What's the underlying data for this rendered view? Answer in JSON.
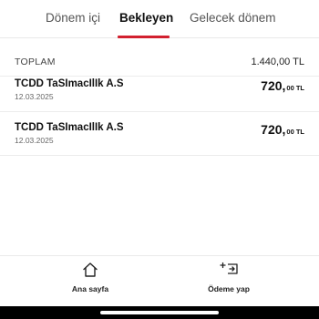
{
  "tabs": [
    {
      "label": "Dönem içi",
      "active": false
    },
    {
      "label": "Bekleyen",
      "active": true
    },
    {
      "label": "Gelecek dönem",
      "active": false
    }
  ],
  "accent_color": "#d2202f",
  "summary": {
    "label": "TOPLAM",
    "value": "1.440,00 TL"
  },
  "items": [
    {
      "name": "TCDD TaSImacIlIk A.S",
      "date": "12.03.2025",
      "amount_main": "720,",
      "amount_cents": "00 TL"
    },
    {
      "name": "TCDD TaSImacIlIk A.S",
      "date": "12.03.2025",
      "amount_main": "720,",
      "amount_cents": "00 TL"
    }
  ],
  "bottom_nav": [
    {
      "label": "Ana sayfa",
      "icon": "home-icon"
    },
    {
      "label": "Ödeme yap",
      "icon": "payment-icon"
    }
  ]
}
